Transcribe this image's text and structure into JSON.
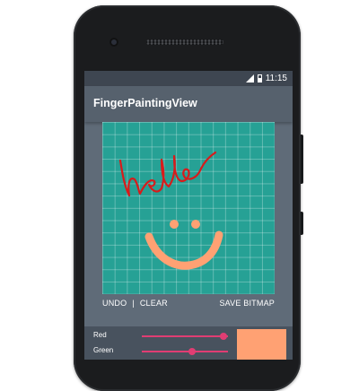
{
  "status": {
    "time": "11:15"
  },
  "app": {
    "title": "FingerPaintingView"
  },
  "canvas": {
    "background_color": "#26a195",
    "grid": true,
    "strokes": [
      {
        "description": "red handwriting 'hello'",
        "color": "#d81b1b"
      },
      {
        "description": "orange smiley face",
        "color": "#ffa173"
      }
    ]
  },
  "actions": {
    "undo": "UNDO",
    "separator": "|",
    "clear": "CLEAR",
    "save": "SAVE BITMAP"
  },
  "color_controls": {
    "red_label": "Red",
    "green_label": "Green",
    "red_fraction": 0.95,
    "green_fraction": 0.58,
    "accent": "#e03d73",
    "swatch_color": "#ffa173"
  }
}
